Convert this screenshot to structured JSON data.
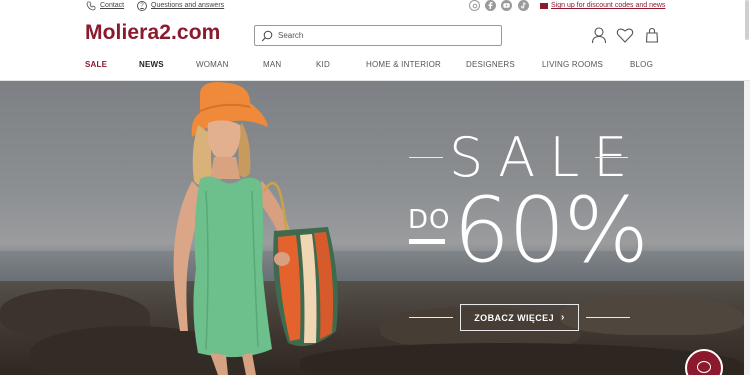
{
  "topbar": {
    "contact_label": "Contact",
    "faq_label": "Questions and answers",
    "faq_icon": "?",
    "social_icons": [
      "instagram-icon",
      "facebook-icon",
      "youtube-icon",
      "tiktok-icon"
    ],
    "newsletter_label": "Sign up for discount codes and news"
  },
  "header": {
    "logo": "Moliera2.com",
    "search_placeholder": "Search",
    "icons": [
      "account-icon",
      "wishlist-icon",
      "bag-icon"
    ]
  },
  "nav": {
    "items": [
      "SALE",
      "NEWS",
      "WOMAN",
      "MAN",
      "KID",
      "HOME & INTERIOR",
      "DESIGNERS",
      "LIVING ROOMS",
      "BLOG"
    ]
  },
  "hero": {
    "headline": "SALE",
    "prefix": "DO",
    "discount": "60%",
    "cta_label": "ZOBACZ WIĘCEJ",
    "cta_chevron": "›"
  },
  "colors": {
    "brand": "#8b1a2f",
    "text": "#333333",
    "hero_text": "#ffffff"
  }
}
